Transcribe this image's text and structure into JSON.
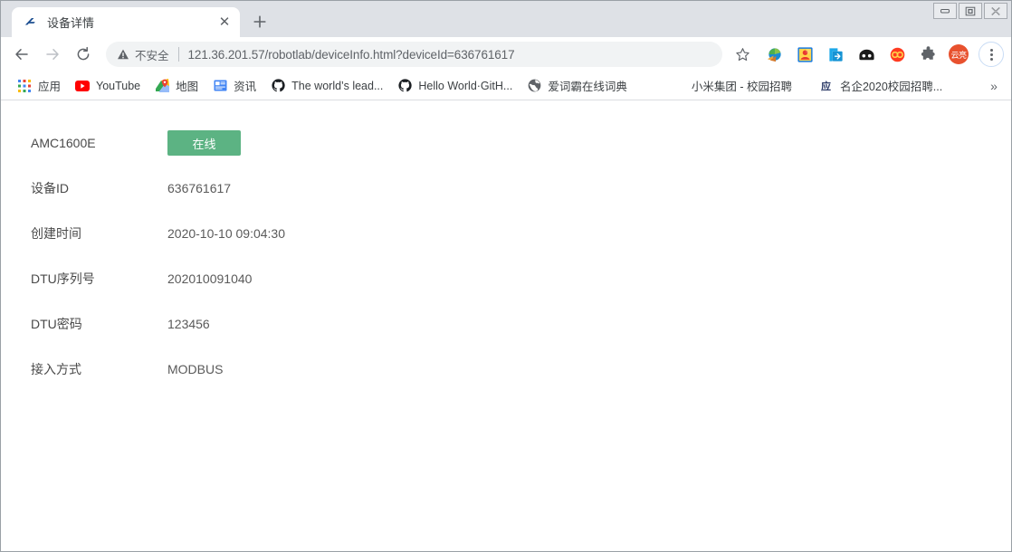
{
  "window": {
    "controls": [
      {
        "name": "minimize",
        "glyph": "–"
      },
      {
        "name": "restore",
        "glyph": "❐"
      },
      {
        "name": "close",
        "glyph": "✕"
      }
    ]
  },
  "tabstrip": {
    "tab": {
      "title": "设备详情",
      "favicon": "logo-a-icon",
      "close_glyph": "✕"
    },
    "new_tab_glyph": "+",
    "new_tab_name": "new-tab-button"
  },
  "toolbar": {
    "back_glyph": "←",
    "forward_glyph": "→",
    "reload_glyph": "↻",
    "security_label": "不安全",
    "url": "121.36.201.57/robotlab/deviceInfo.html?deviceId=636761617",
    "star_glyph": "☆",
    "profile_initials": "云亮",
    "extensions": [
      {
        "name": "download-manager-icon",
        "label": ""
      },
      {
        "name": "screenshot-icon",
        "label": ""
      },
      {
        "name": "share-to-icon",
        "label": ""
      },
      {
        "name": "dark-reader-icon",
        "label": ""
      },
      {
        "name": "infinity-icon",
        "label": ""
      },
      {
        "name": "extensions-puzzle-icon",
        "label": ""
      }
    ]
  },
  "bookmarks": {
    "items": [
      {
        "label": "应用",
        "icon": "apps-grid-icon"
      },
      {
        "label": "YouTube",
        "icon": "youtube-icon"
      },
      {
        "label": "地图",
        "icon": "maps-pin-icon"
      },
      {
        "label": "资讯",
        "icon": "news-icon"
      },
      {
        "label": "The world’s lead...",
        "icon": "github-icon"
      },
      {
        "label": "Hello World·GitH...",
        "icon": "github-icon"
      },
      {
        "label": "爱词霸在线词典",
        "icon": "globe-icon"
      },
      {
        "label": "小米集团 - 校园招聘",
        "icon": ""
      },
      {
        "label": "名企2020校园招聘...",
        "icon": "yingjiesheng-icon"
      }
    ],
    "overflow_glyph": "»"
  },
  "page": {
    "device_name": "AMC1600E",
    "status": "在线",
    "status_color": "#5cb383",
    "rows": [
      {
        "label": "设备ID",
        "value": "636761617"
      },
      {
        "label": "创建时间",
        "value": "2020-10-10 09:04:30"
      },
      {
        "label": "DTU序列号",
        "value": "202010091040"
      },
      {
        "label": "DTU密码",
        "value": "123456"
      },
      {
        "label": "接入方式",
        "value": "MODBUS"
      }
    ]
  }
}
